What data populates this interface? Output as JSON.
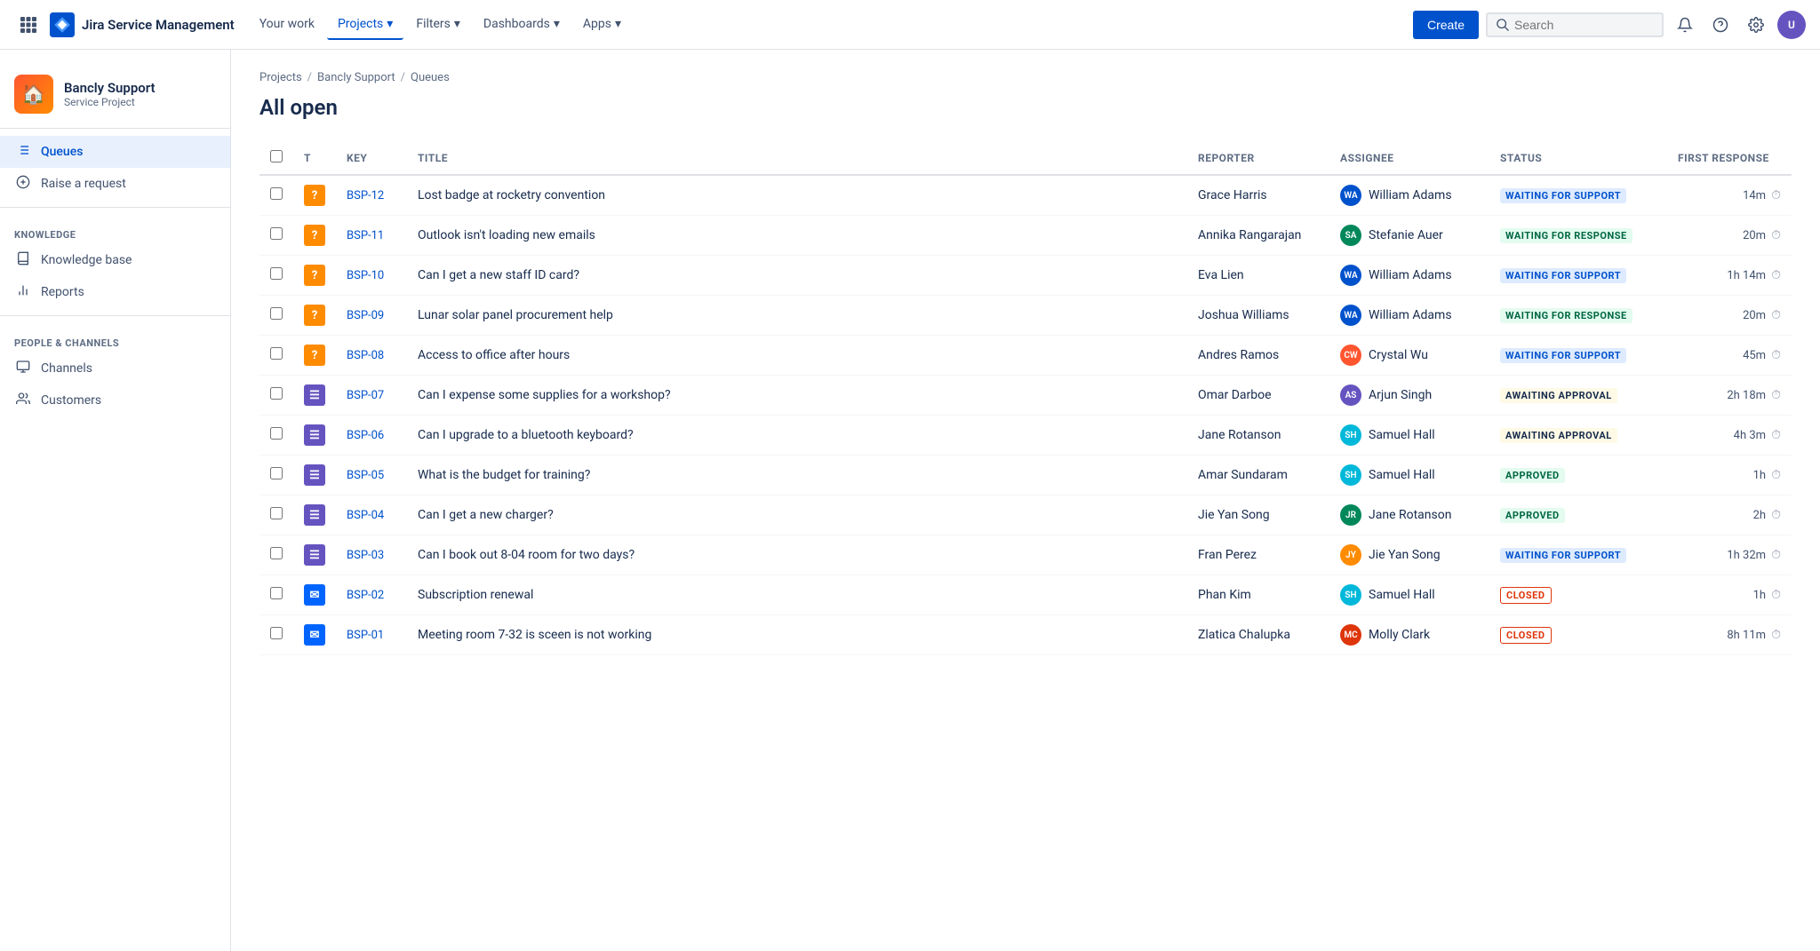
{
  "topnav": {
    "brand": "Jira Service Management",
    "links": [
      {
        "label": "Your work",
        "active": false
      },
      {
        "label": "Projects",
        "hasArrow": true,
        "active": true
      },
      {
        "label": "Filters",
        "hasArrow": true,
        "active": false
      },
      {
        "label": "Dashboards",
        "hasArrow": true,
        "active": false
      },
      {
        "label": "Apps",
        "hasArrow": true,
        "active": false
      }
    ],
    "create_label": "Create",
    "search_placeholder": "Search"
  },
  "sidebar": {
    "project_name": "Bancly Support",
    "project_type": "Service Project",
    "nav_items": [
      {
        "id": "queues",
        "label": "Queues",
        "active": true,
        "icon": "list"
      },
      {
        "id": "raise",
        "label": "Raise a request",
        "active": false,
        "icon": "plus-circle"
      }
    ],
    "knowledge_section": "KNOWLEDGE",
    "knowledge_items": [
      {
        "id": "kb",
        "label": "Knowledge base",
        "active": false,
        "icon": "book"
      },
      {
        "id": "reports",
        "label": "Reports",
        "active": false,
        "icon": "bar-chart"
      }
    ],
    "people_section": "PEOPLE & CHANNELS",
    "people_items": [
      {
        "id": "channels",
        "label": "Channels",
        "active": false,
        "icon": "monitor"
      },
      {
        "id": "customers",
        "label": "Customers",
        "active": false,
        "icon": "users"
      }
    ]
  },
  "breadcrumb": {
    "items": [
      "Projects",
      "Bancly Support",
      "Queues"
    ]
  },
  "page_title": "All open",
  "table": {
    "columns": [
      "",
      "T",
      "Key",
      "Title",
      "Reporter",
      "Assignee",
      "Status",
      "First response"
    ],
    "rows": [
      {
        "key": "BSP-12",
        "type": "question",
        "title": "Lost badge at rocketry convention",
        "reporter": "Grace Harris",
        "assignee": "William Adams",
        "assignee_initials": "WA",
        "assignee_color": "av-blue",
        "status": "WAITING FOR SUPPORT",
        "status_class": "status-waiting-support",
        "first_response": "14m",
        "checked": false
      },
      {
        "key": "BSP-11",
        "type": "question",
        "title": "Outlook isn't loading new emails",
        "reporter": "Annika Rangarajan",
        "assignee": "Stefanie Auer",
        "assignee_initials": "SA",
        "assignee_color": "av-green",
        "status": "WAITING FOR RESPONSE",
        "status_class": "status-waiting-response",
        "first_response": "20m",
        "checked": false
      },
      {
        "key": "BSP-10",
        "type": "question",
        "title": "Can I get a new staff ID card?",
        "reporter": "Eva Lien",
        "assignee": "William Adams",
        "assignee_initials": "WA",
        "assignee_color": "av-blue",
        "status": "WAITING FOR SUPPORT",
        "status_class": "status-waiting-support",
        "first_response": "1h 14m",
        "checked": false
      },
      {
        "key": "BSP-09",
        "type": "question",
        "title": "Lunar solar panel procurement help",
        "reporter": "Joshua Williams",
        "assignee": "William Adams",
        "assignee_initials": "WA",
        "assignee_color": "av-blue",
        "status": "WAITING FOR RESPONSE",
        "status_class": "status-waiting-response",
        "first_response": "20m",
        "checked": false
      },
      {
        "key": "BSP-08",
        "type": "question",
        "title": "Access to office after hours",
        "reporter": "Andres Ramos",
        "assignee": "Crystal Wu",
        "assignee_initials": "CW",
        "assignee_color": "av-pink",
        "status": "WAITING FOR SUPPORT",
        "status_class": "status-waiting-support",
        "first_response": "45m",
        "checked": false
      },
      {
        "key": "BSP-07",
        "type": "task",
        "title": "Can I expense some supplies for a workshop?",
        "reporter": "Omar Darboe",
        "assignee": "Arjun Singh",
        "assignee_initials": "AS",
        "assignee_color": "av-purple",
        "status": "AWAITING APPROVAL",
        "status_class": "status-awaiting-approval",
        "first_response": "2h 18m",
        "checked": false
      },
      {
        "key": "BSP-06",
        "type": "task",
        "title": "Can I upgrade to a bluetooth keyboard?",
        "reporter": "Jane Rotanson",
        "assignee": "Samuel Hall",
        "assignee_initials": "SH",
        "assignee_color": "av-teal",
        "status": "AWAITING APPROVAL",
        "status_class": "status-awaiting-approval",
        "first_response": "4h 3m",
        "checked": false
      },
      {
        "key": "BSP-05",
        "type": "task",
        "title": "What is the budget for training?",
        "reporter": "Amar Sundaram",
        "assignee": "Samuel Hall",
        "assignee_initials": "SH",
        "assignee_color": "av-teal",
        "status": "APPROVED",
        "status_class": "status-approved",
        "first_response": "1h",
        "checked": false
      },
      {
        "key": "BSP-04",
        "type": "task",
        "title": "Can I get a new charger?",
        "reporter": "Jie Yan Song",
        "assignee": "Jane Rotanson",
        "assignee_initials": "JR",
        "assignee_color": "av-green",
        "status": "APPROVED",
        "status_class": "status-approved",
        "first_response": "2h",
        "checked": false
      },
      {
        "key": "BSP-03",
        "type": "task",
        "title": "Can I book out 8-04 room for two days?",
        "reporter": "Fran Perez",
        "assignee": "Jie Yan Song",
        "assignee_initials": "JY",
        "assignee_color": "av-orange",
        "status": "WAITING FOR SUPPORT",
        "status_class": "status-waiting-support",
        "first_response": "1h 32m",
        "checked": false
      },
      {
        "key": "BSP-02",
        "type": "email",
        "title": "Subscription renewal",
        "reporter": "Phan Kim",
        "assignee": "Samuel Hall",
        "assignee_initials": "SH",
        "assignee_color": "av-teal",
        "status": "CLOSED",
        "status_class": "status-closed",
        "first_response": "1h",
        "checked": false
      },
      {
        "key": "BSP-01",
        "type": "email",
        "title": "Meeting room 7-32 is sceen is not working",
        "reporter": "Zlatica Chalupka",
        "assignee": "Molly Clark",
        "assignee_initials": "MC",
        "assignee_color": "av-red",
        "status": "CLOSED",
        "status_class": "status-closed",
        "first_response": "8h 11m",
        "checked": false
      }
    ]
  }
}
